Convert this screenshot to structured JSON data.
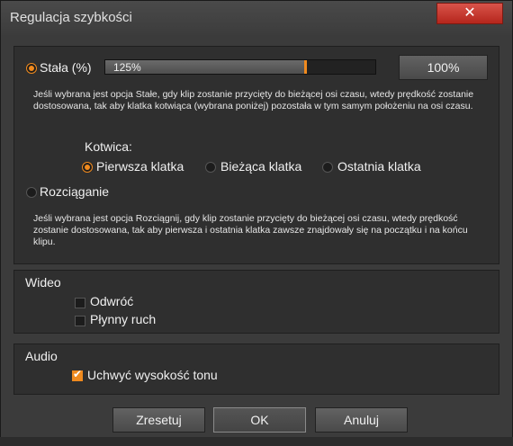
{
  "window": {
    "title": "Regulacja szybkości",
    "close_glyph": "✕"
  },
  "constant": {
    "label": "Stała (%)",
    "selected": true,
    "slider_value_label": "125%",
    "slider_fraction": 0.735,
    "reset_percent_label": "100%",
    "description": "Jeśli wybrana jest opcja Stałe, gdy klip zostanie przycięty do bieżącej osi czasu, wtedy prędkość zostanie dostosowana, tak aby klatka kotwiąca (wybrana poniżej) pozostała w tym samym położeniu na osi czasu."
  },
  "anchor": {
    "label": "Kotwica:",
    "options": [
      "Pierwsza klatka",
      "Bieżąca klatka",
      "Ostatnia klatka"
    ],
    "selected_index": 0
  },
  "stretch": {
    "label": "Rozciąganie",
    "selected": false,
    "description": "Jeśli wybrana jest opcja Rozciągnij, gdy klip zostanie przycięty do bieżącej osi czasu, wtedy prędkość zostanie dostosowana, tak aby pierwsza i ostatnia klatka zawsze znajdowały się na początku i na końcu klipu."
  },
  "video": {
    "heading": "Wideo",
    "reverse_label": "Odwróć",
    "reverse_checked": false,
    "smooth_label": "Płynny ruch",
    "smooth_checked": false
  },
  "audio": {
    "heading": "Audio",
    "pitch_label": "Uchwyć wysokość tonu",
    "pitch_checked": true
  },
  "buttons": {
    "reset": "Zresetuj",
    "ok": "OK",
    "cancel": "Anuluj"
  },
  "colors": {
    "accent": "#f08a1e",
    "close": "#c9372c"
  }
}
